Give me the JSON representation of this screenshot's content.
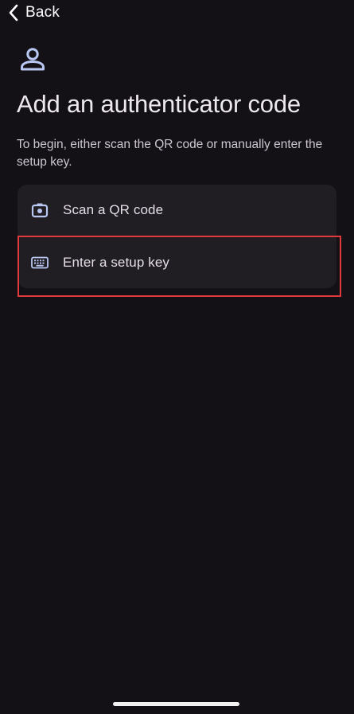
{
  "nav": {
    "back_label": "Back",
    "back_icon": "chevron-left-icon"
  },
  "header": {
    "icon": "person-icon",
    "title": "Add an authenticator code",
    "subtitle": "To begin, either scan the QR code or manually enter the setup key."
  },
  "options": [
    {
      "icon": "camera-icon",
      "label": "Scan a QR code"
    },
    {
      "icon": "keyboard-icon",
      "label": "Enter a setup key",
      "highlighted": true
    }
  ],
  "colors": {
    "background": "#131116",
    "card": "#201d23",
    "icon_accent": "#b9c8f2",
    "highlight_border": "#e0393e",
    "text_primary": "#ece8ec"
  }
}
